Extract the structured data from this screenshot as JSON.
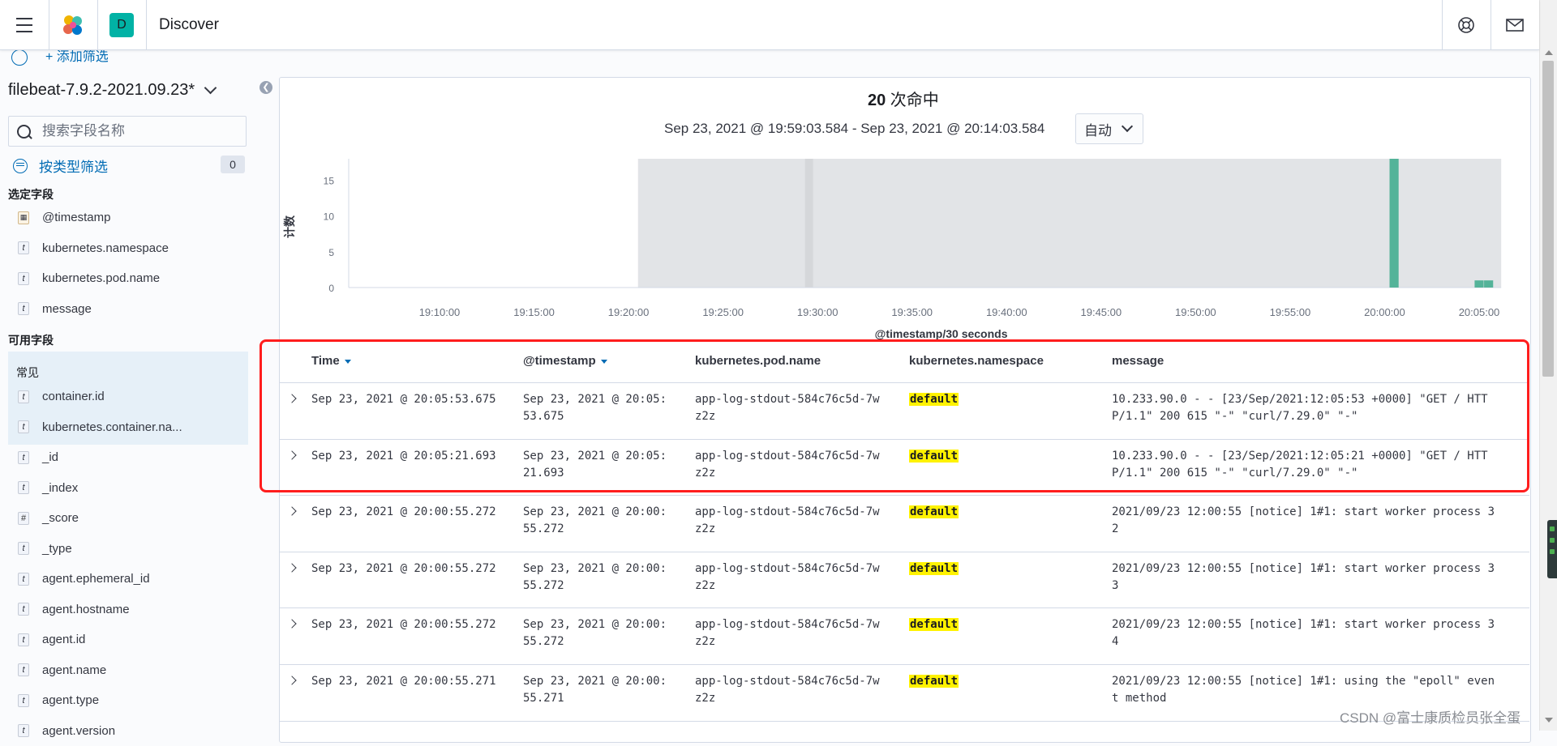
{
  "header": {
    "app_title": "Discover",
    "space_initial": "D"
  },
  "sidebar": {
    "add_filter": "+ 添加筛选",
    "index_pattern": "filebeat-7.9.2-2021.09.23*",
    "search_placeholder": "搜索字段名称",
    "type_filter_label": "按类型筛选",
    "type_filter_count": "0",
    "selected_title": "选定字段",
    "selected_fields": [
      {
        "type": "date",
        "name": "@timestamp"
      },
      {
        "type": "t",
        "name": "kubernetes.namespace"
      },
      {
        "type": "t",
        "name": "kubernetes.pod.name"
      },
      {
        "type": "t",
        "name": "message"
      }
    ],
    "available_title": "可用字段",
    "popular_label": "常见",
    "popular_fields": [
      {
        "type": "t",
        "name": "container.id"
      },
      {
        "type": "t",
        "name": "kubernetes.container.na..."
      }
    ],
    "available_fields": [
      {
        "type": "t",
        "name": "_id"
      },
      {
        "type": "t",
        "name": "_index"
      },
      {
        "type": "#",
        "name": "_score"
      },
      {
        "type": "t",
        "name": "_type"
      },
      {
        "type": "t",
        "name": "agent.ephemeral_id"
      },
      {
        "type": "t",
        "name": "agent.hostname"
      },
      {
        "type": "t",
        "name": "agent.id"
      },
      {
        "type": "t",
        "name": "agent.name"
      },
      {
        "type": "t",
        "name": "agent.type"
      },
      {
        "type": "t",
        "name": "agent.version"
      }
    ]
  },
  "summary": {
    "hits_count": "20",
    "hits_label": " 次命中",
    "time_range": "Sep 23, 2021 @ 19:59:03.584 - Sep 23, 2021 @ 20:14:03.584",
    "interval": "自动"
  },
  "chart_data": {
    "type": "bar",
    "ylabel": "计数",
    "xlabel": "@timestamp/30 seconds",
    "yticks": [
      "0",
      "5",
      "10",
      "15"
    ],
    "xticks": [
      "19:10:00",
      "19:15:00",
      "19:20:00",
      "19:25:00",
      "19:30:00",
      "19:35:00",
      "19:40:00",
      "19:45:00",
      "19:50:00",
      "19:55:00",
      "20:00:00",
      "20:05:00"
    ],
    "ylim": [
      0,
      18
    ],
    "shaded_range": [
      "19:20:30",
      "20:06:10"
    ],
    "bars": [
      {
        "x": "20:00:30",
        "value": 18
      },
      {
        "x": "20:05:00",
        "value": 1
      },
      {
        "x": "20:05:30",
        "value": 1
      }
    ],
    "bar_color": "#54b399"
  },
  "table": {
    "columns": [
      {
        "label": "Time",
        "sort": true
      },
      {
        "label": "@timestamp",
        "sort": true
      },
      {
        "label": "kubernetes.pod.name",
        "sort": false
      },
      {
        "label": "kubernetes.namespace",
        "sort": false
      },
      {
        "label": "message",
        "sort": false
      }
    ],
    "rows": [
      {
        "time": "Sep 23, 2021 @ 20:05:53.675",
        "timestamp": "Sep 23, 2021 @ 20:05:\n53.675",
        "pod": "app-log-stdout-584c76c5d-7w\nz2z",
        "namespace": "default",
        "message": "10.233.90.0 - - [23/Sep/2021:12:05:53 +0000] \"GET / HTT\nP/1.1\" 200 615 \"-\" \"curl/7.29.0\" \"-\""
      },
      {
        "time": "Sep 23, 2021 @ 20:05:21.693",
        "timestamp": "Sep 23, 2021 @ 20:05:\n21.693",
        "pod": "app-log-stdout-584c76c5d-7w\nz2z",
        "namespace": "default",
        "message": "10.233.90.0 - - [23/Sep/2021:12:05:21 +0000] \"GET / HTT\nP/1.1\" 200 615 \"-\" \"curl/7.29.0\" \"-\""
      },
      {
        "time": "Sep 23, 2021 @ 20:00:55.272",
        "timestamp": "Sep 23, 2021 @ 20:00:\n55.272",
        "pod": "app-log-stdout-584c76c5d-7w\nz2z",
        "namespace": "default",
        "message": "2021/09/23 12:00:55 [notice] 1#1: start worker process 3\n2"
      },
      {
        "time": "Sep 23, 2021 @ 20:00:55.272",
        "timestamp": "Sep 23, 2021 @ 20:00:\n55.272",
        "pod": "app-log-stdout-584c76c5d-7w\nz2z",
        "namespace": "default",
        "message": "2021/09/23 12:00:55 [notice] 1#1: start worker process 3\n3"
      },
      {
        "time": "Sep 23, 2021 @ 20:00:55.272",
        "timestamp": "Sep 23, 2021 @ 20:00:\n55.272",
        "pod": "app-log-stdout-584c76c5d-7w\nz2z",
        "namespace": "default",
        "message": "2021/09/23 12:00:55 [notice] 1#1: start worker process 3\n4"
      },
      {
        "time": "Sep 23, 2021 @ 20:00:55.271",
        "timestamp": "Sep 23, 2021 @ 20:00:\n55.271",
        "pod": "app-log-stdout-584c76c5d-7w\nz2z",
        "namespace": "default",
        "message": "2021/09/23 12:00:55 [notice] 1#1: using the \"epoll\" even\nt method"
      }
    ]
  },
  "watermark": "CSDN @富士康质检员张全蛋"
}
